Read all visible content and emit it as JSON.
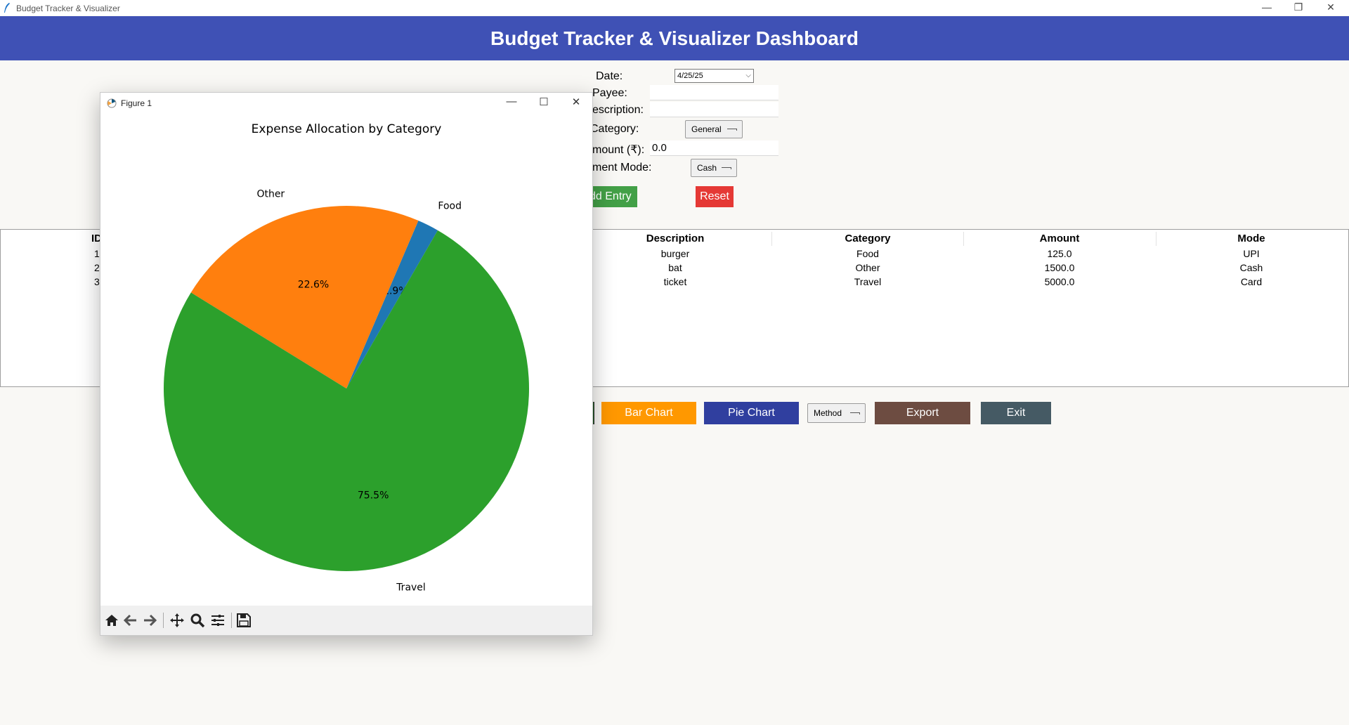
{
  "window": {
    "title": "Budget Tracker & Visualizer",
    "controls": {
      "minimize": "—",
      "maximize": "❐",
      "close": "✕"
    }
  },
  "banner": {
    "title": "Budget Tracker & Visualizer Dashboard",
    "color": "#3f51b5"
  },
  "form": {
    "date_label": "Date:",
    "date_value": "4/25/25",
    "payee_label": "Payee:",
    "payee_value": "",
    "description_label": "escription:",
    "description_value": "",
    "category_label": "Category:",
    "category_value": "General",
    "amount_label": "mount (₹):",
    "amount_value": "0.0",
    "payment_mode_label": "ment Mode:",
    "payment_mode_value": "Cash",
    "add_button": "dd Entry",
    "reset_button": "Reset"
  },
  "table": {
    "partial_id_header": "ID",
    "partial_id_values": [
      "1",
      "2",
      "3"
    ],
    "headers": [
      "Description",
      "Category",
      "Amount",
      "Mode"
    ],
    "rows": [
      [
        "burger",
        "Food",
        "125.0",
        "UPI"
      ],
      [
        "bat",
        "Other",
        "1500.0",
        "Cash"
      ],
      [
        "ticket",
        "Travel",
        "5000.0",
        "Card"
      ]
    ]
  },
  "actions": {
    "bar_chart": "Bar Chart",
    "pie_chart": "Pie Chart",
    "method": "Method",
    "export": "Export",
    "exit": "Exit"
  },
  "figure": {
    "title": "Figure 1",
    "controls": {
      "minimize": "—",
      "maximize": "☐",
      "close": "✕"
    },
    "toolbar_icons": [
      "home-icon",
      "back-arrow-icon",
      "forward-arrow-icon",
      "pan-icon",
      "zoom-icon",
      "configure-subplots-icon",
      "save-icon"
    ]
  },
  "chart_data": {
    "type": "pie",
    "title": "Expense Allocation by Category",
    "categories": [
      "Food",
      "Other",
      "Travel"
    ],
    "values": [
      125.0,
      1500.0,
      5000.0
    ],
    "pct_labels": [
      "1.9%",
      "22.6%",
      "75.5%"
    ],
    "colors": [
      "#1f77b4",
      "#ff7f0e",
      "#2ca02c"
    ],
    "start_angle_deg": 60
  }
}
